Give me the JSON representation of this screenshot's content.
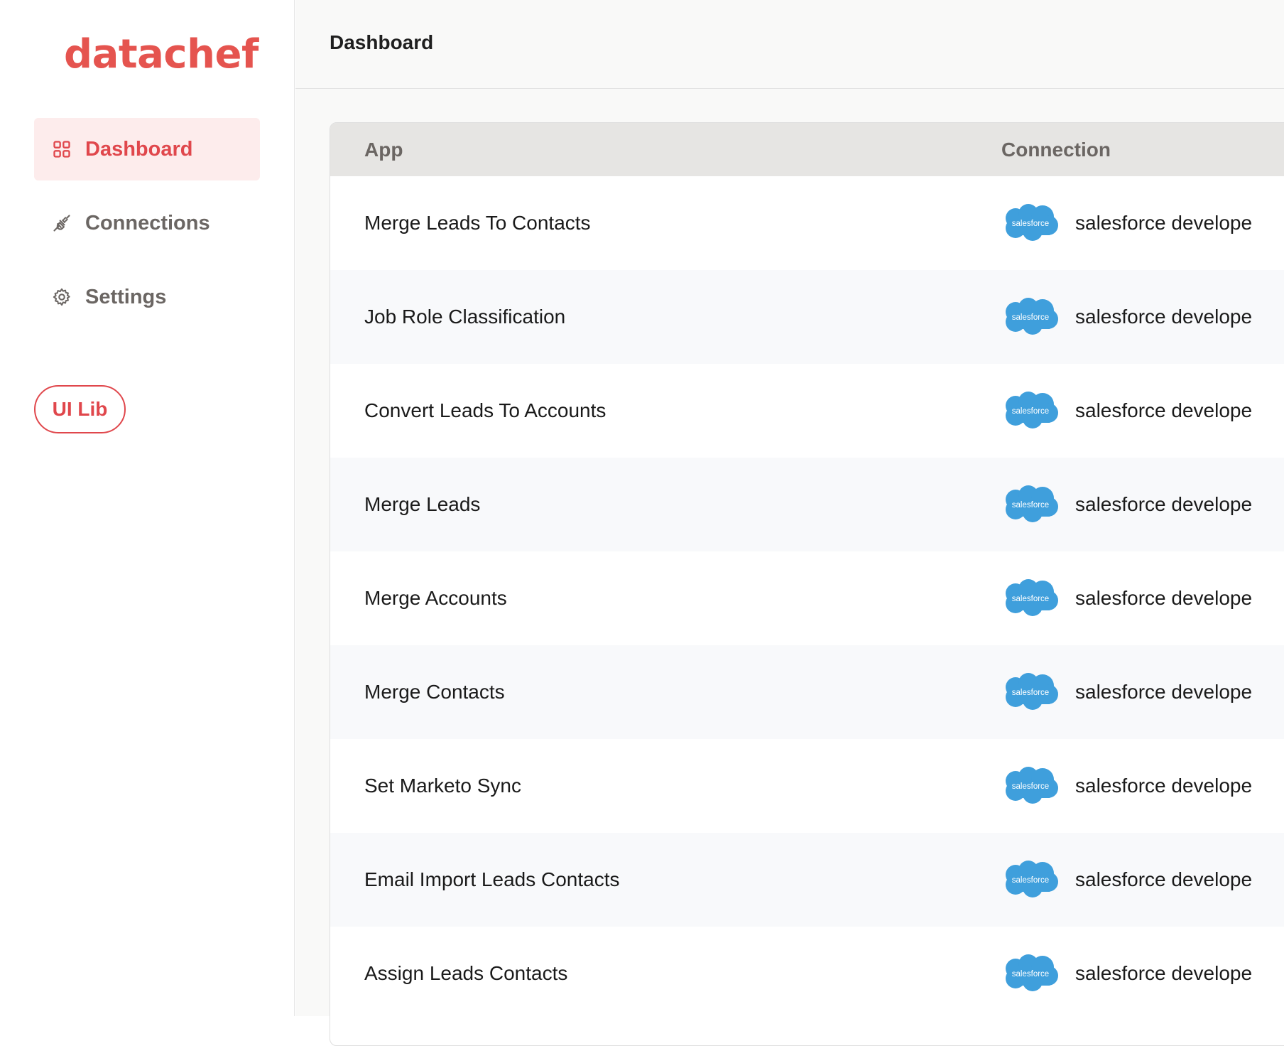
{
  "brand": {
    "logo_text": "datachef",
    "accent": "#e0474c"
  },
  "sidebar": {
    "items": [
      {
        "label": "Dashboard",
        "icon": "grid-icon",
        "active": true
      },
      {
        "label": "Connections",
        "icon": "plug-icon",
        "active": false
      },
      {
        "label": "Settings",
        "icon": "gear-icon",
        "active": false
      }
    ],
    "ui_lib_label": "UI Lib"
  },
  "header": {
    "title": "Dashboard"
  },
  "table": {
    "columns": [
      "App",
      "Connection"
    ],
    "rows": [
      {
        "app": "Merge Leads To Contacts",
        "connection_logo": "salesforce",
        "connection": "salesforce develope"
      },
      {
        "app": "Job Role Classification",
        "connection_logo": "salesforce",
        "connection": "salesforce develope"
      },
      {
        "app": "Convert Leads To Accounts",
        "connection_logo": "salesforce",
        "connection": "salesforce develope"
      },
      {
        "app": "Merge Leads",
        "connection_logo": "salesforce",
        "connection": "salesforce develope"
      },
      {
        "app": "Merge Accounts",
        "connection_logo": "salesforce",
        "connection": "salesforce develope"
      },
      {
        "app": "Merge Contacts",
        "connection_logo": "salesforce",
        "connection": "salesforce develope"
      },
      {
        "app": "Set Marketo Sync",
        "connection_logo": "salesforce",
        "connection": "salesforce develope"
      },
      {
        "app": "Email Import Leads Contacts",
        "connection_logo": "salesforce",
        "connection": "salesforce develope"
      },
      {
        "app": "Assign Leads Contacts",
        "connection_logo": "salesforce",
        "connection": "salesforce develope"
      }
    ]
  },
  "colors": {
    "salesforce_blue": "#3f9fdc"
  }
}
